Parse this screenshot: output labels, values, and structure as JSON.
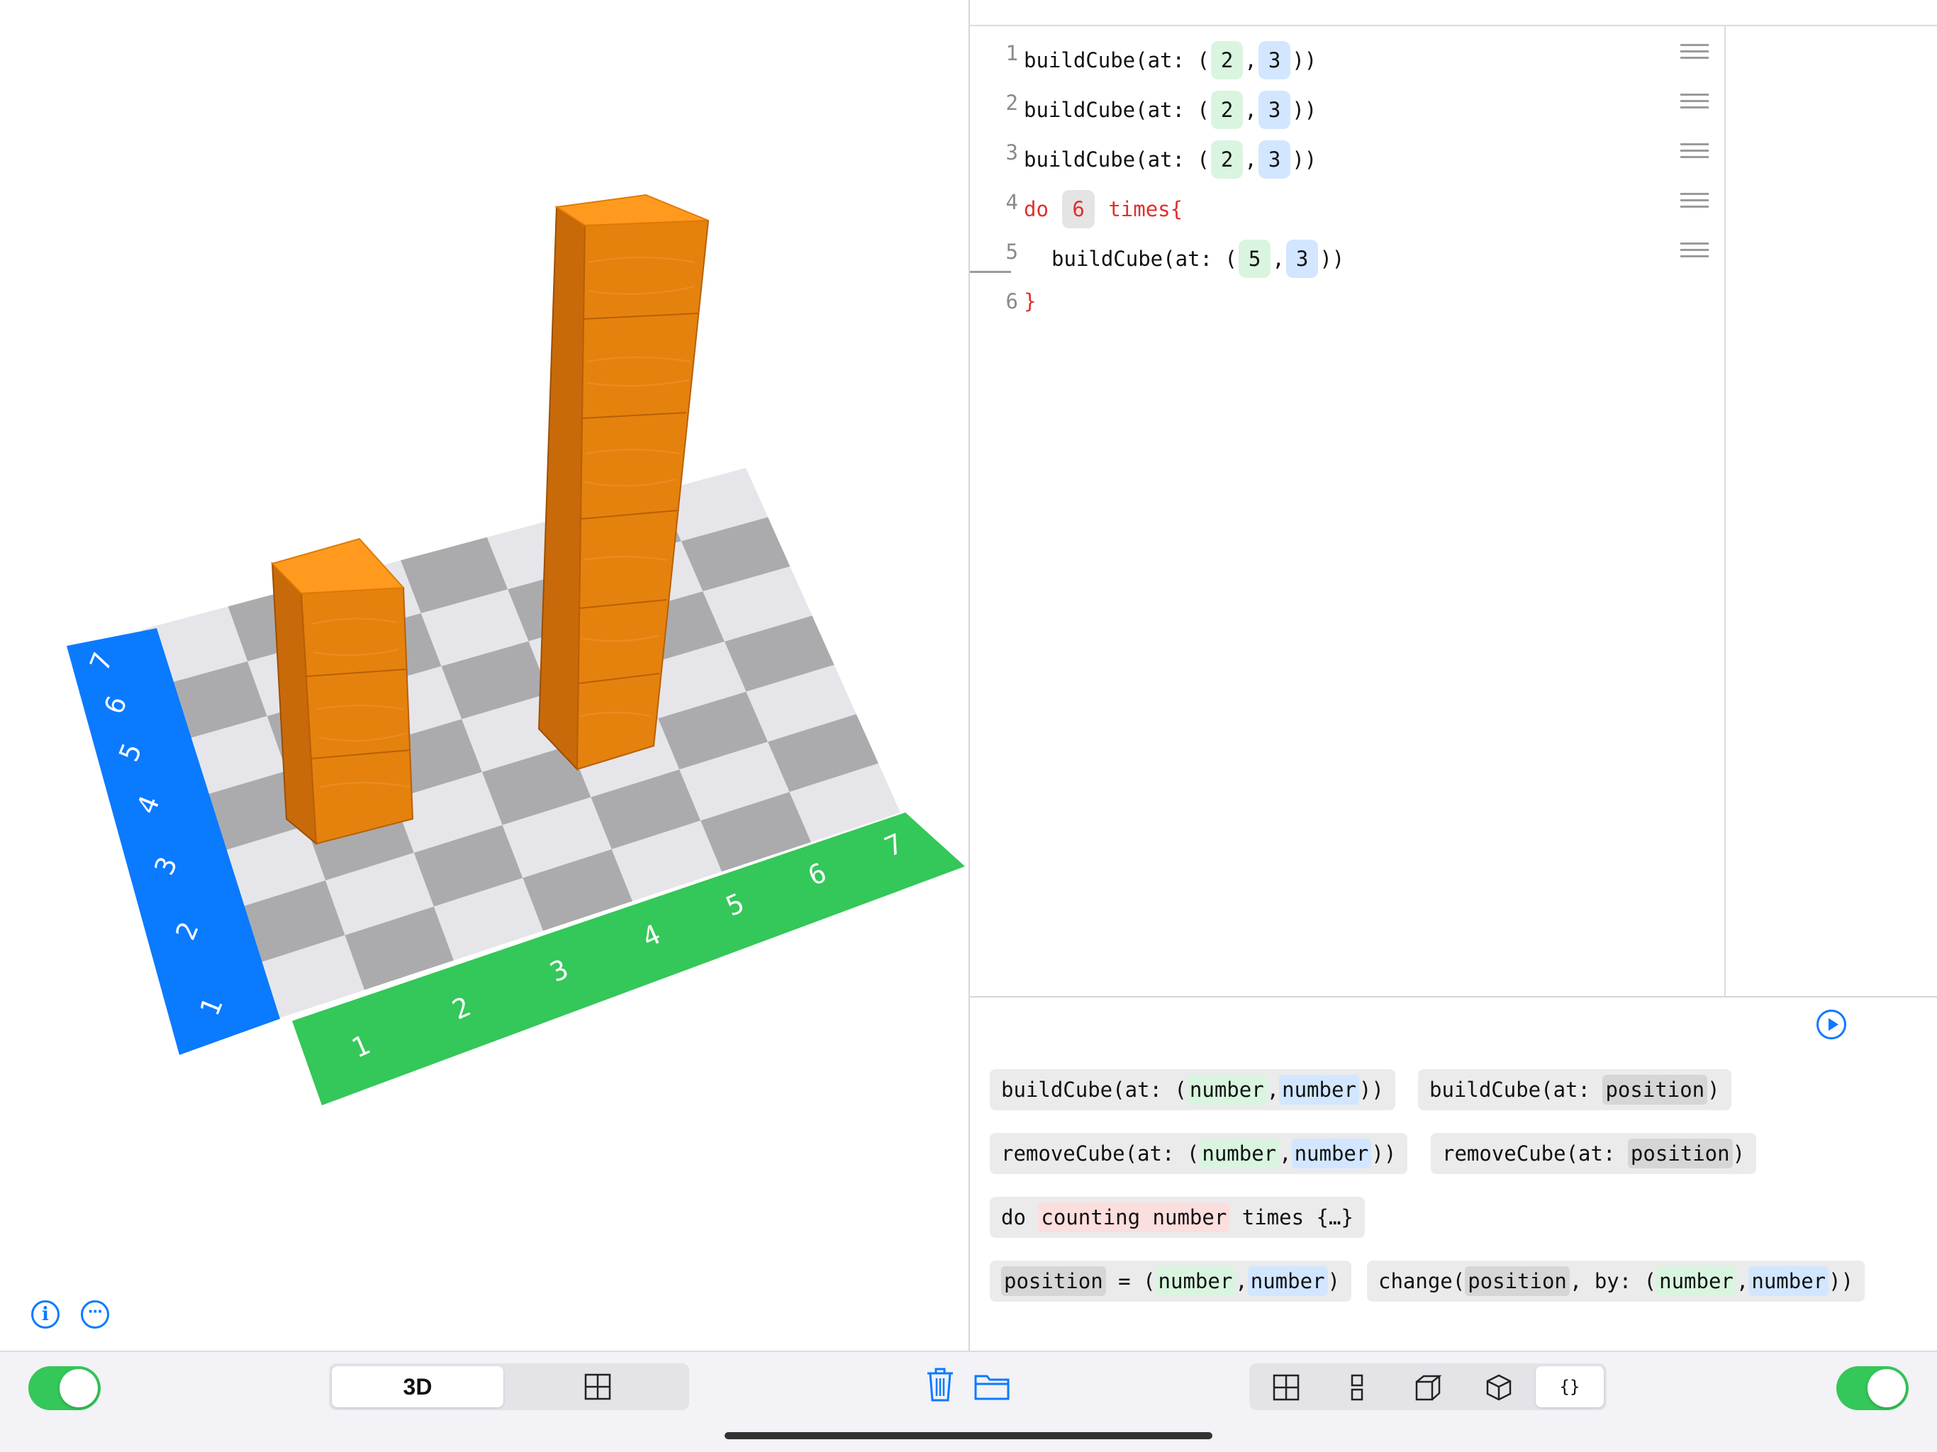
{
  "scene": {
    "x_axis_labels": [
      "1",
      "2",
      "3",
      "4",
      "5",
      "6",
      "7"
    ],
    "y_axis_labels": [
      "1",
      "2",
      "3",
      "4",
      "5",
      "6",
      "7"
    ],
    "x_axis_color": "#34c759",
    "y_axis_color": "#0a7aff",
    "cube_color": "#ff9a1e",
    "stacks": [
      {
        "column": 2,
        "row": 3,
        "height": 3
      },
      {
        "column": 5,
        "row": 3,
        "height": 6
      }
    ]
  },
  "code": {
    "lines": [
      {
        "num": "1",
        "text": "buildCube(at: (",
        "a": "2",
        "sep": ",",
        "b": "3",
        "end": "))"
      },
      {
        "num": "2",
        "text": "buildCube(at: (",
        "a": "2",
        "sep": ",",
        "b": "3",
        "end": "))"
      },
      {
        "num": "3",
        "text": "buildCube(at: (",
        "a": "2",
        "sep": ",",
        "b": "3",
        "end": "))"
      },
      {
        "num": "4",
        "kw1": "do",
        "count": "6",
        "kw2": "times{"
      },
      {
        "num": "5",
        "text": "buildCube(at: (",
        "a": "5",
        "sep": ",",
        "b": "3",
        "end": "))"
      },
      {
        "num": "6",
        "close": "}"
      }
    ]
  },
  "snippets": {
    "s1": {
      "pre": "buildCube(at: (",
      "p1": "number",
      "sep": ",",
      "p2": "number",
      "post": "))"
    },
    "s2": {
      "pre": "buildCube(at: ",
      "p1": "position",
      "post": ")"
    },
    "s3": {
      "pre": "removeCube(at: (",
      "p1": "number",
      "sep": ",",
      "p2": "number",
      "post": "))"
    },
    "s4": {
      "pre": "removeCube(at: ",
      "p1": "position",
      "post": ")"
    },
    "s5": {
      "pre": "do ",
      "p1": "counting number",
      "post": " times {…}"
    },
    "s6": {
      "p0": "position",
      "mid": " = (",
      "p1": "number",
      "sep": ",",
      "p2": "number",
      "post": ")"
    },
    "s7": {
      "pre": "change(",
      "p0": "position",
      "mid": ", by: (",
      "p1": "number",
      "sep": ",",
      "p2": "number",
      "post": "))"
    }
  },
  "toolbar": {
    "view_3d_label": "3D",
    "code_tool_label": "{}",
    "left_toggle_on": true,
    "right_toggle_on": true
  }
}
